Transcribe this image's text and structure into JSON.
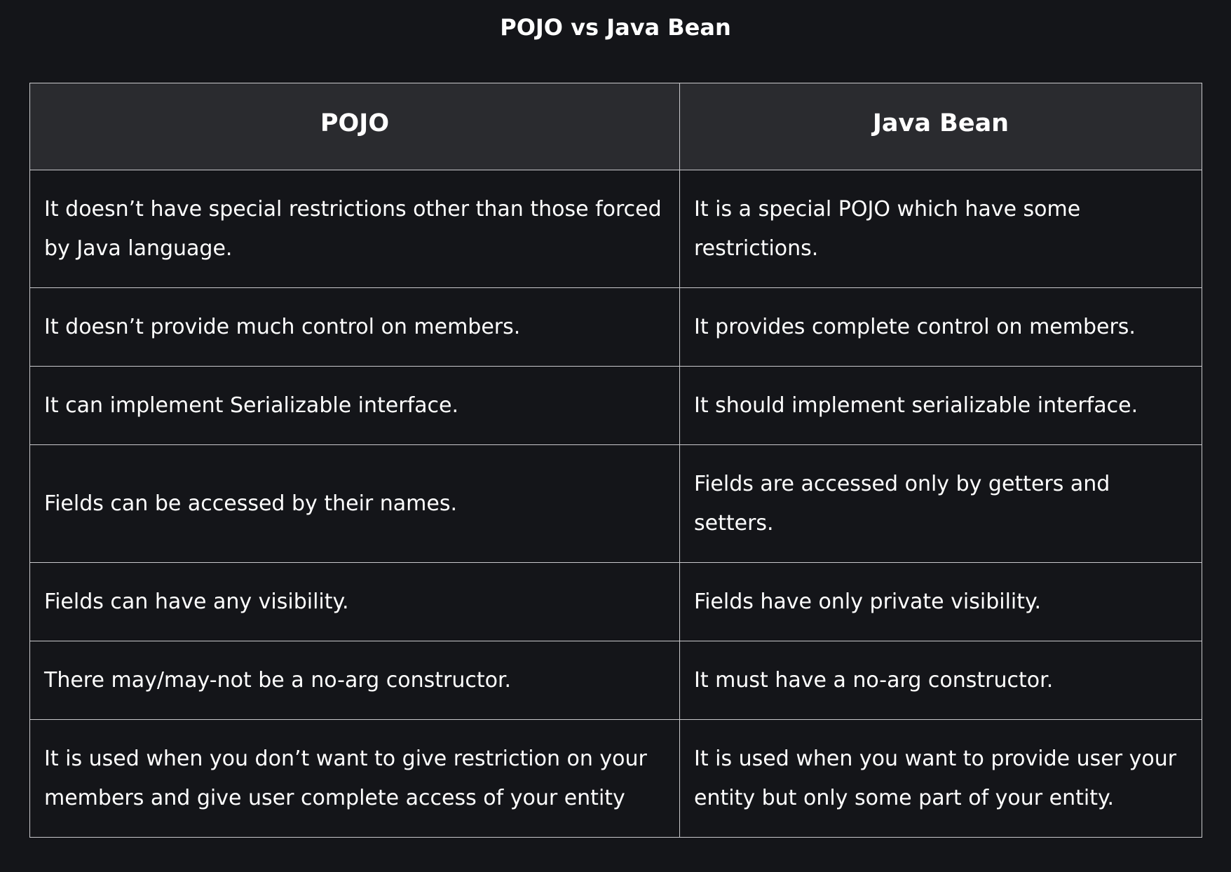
{
  "title": "POJO vs Java Bean",
  "table": {
    "headers": [
      "POJO",
      "Java Bean"
    ],
    "rows": [
      [
        "It doesn’t have special restrictions other than those forced by Java language.",
        "It is a special POJO which have some restrictions."
      ],
      [
        "It doesn’t provide much control on members.",
        "It provides complete control on members."
      ],
      [
        "It can implement Serializable interface.",
        "It should implement serializable interface."
      ],
      [
        "Fields can be accessed by their names.",
        "Fields are accessed only by getters and setters."
      ],
      [
        "Fields can have any visibility.",
        "Fields have only private visibility."
      ],
      [
        "There may/may-not be a no-arg constructor.",
        "It must have a no-arg constructor."
      ],
      [
        "It is used when you don’t want to give restriction on your members and give user complete access of your entity",
        "It is used when you want to provide user your entity but only some part of your entity."
      ]
    ]
  },
  "colors": {
    "background": "#141519",
    "header_background": "#2a2b2f",
    "border": "#c9c9cc",
    "text": "#ffffff"
  }
}
